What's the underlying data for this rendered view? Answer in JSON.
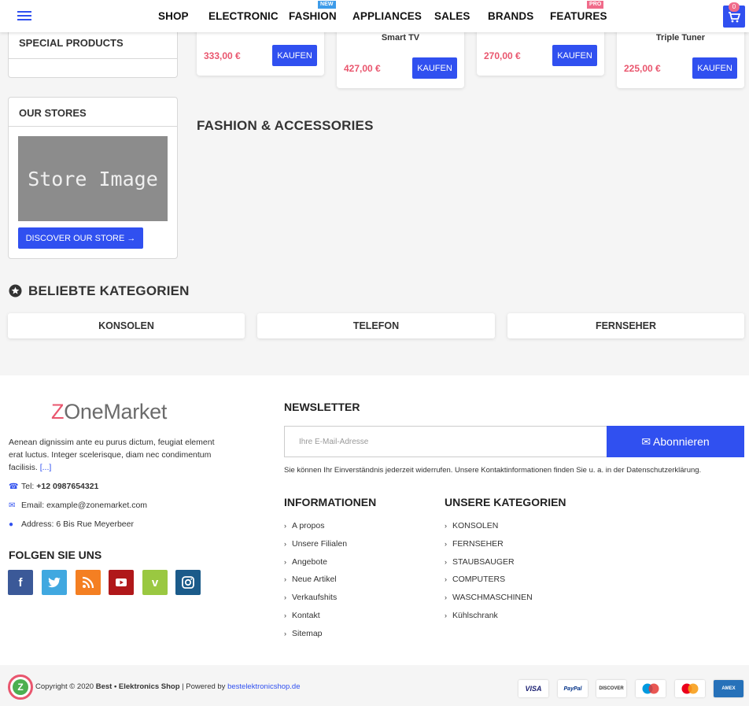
{
  "header": {
    "nav": [
      "SHOP",
      "ELECTRONIC",
      "FASHION",
      "APPLIANCES",
      "SALES",
      "BRANDS",
      "FEATURES"
    ],
    "badge_new": "NEW",
    "badge_pro": "PRO",
    "cart_count": "0"
  },
  "sidebar": {
    "special_title": "SPECIAL PRODUCTS",
    "stores_title": "OUR STORES",
    "store_image_text": "Store Image",
    "discover_label": "DISCOVER OUR STORE →"
  },
  "products": [
    {
      "name": "",
      "price": "333,00 €",
      "button": "KAUFEN"
    },
    {
      "name": "Smart TV",
      "price": "427,00 €",
      "button": "KAUFEN"
    },
    {
      "name": "",
      "price": "270,00 €",
      "button": "KAUFEN"
    },
    {
      "name": "Triple Tuner",
      "price": "225,00 €",
      "button": "KAUFEN"
    }
  ],
  "fashion_title": "FASHION & ACCESSORIES",
  "categories": {
    "title": "BELIEBTE KATEGORIEN",
    "items": [
      "KONSOLEN",
      "TELEFON",
      "FERNSEHER"
    ]
  },
  "footer": {
    "logo_z": "Z",
    "logo_rest": "OneMarket",
    "about": "Aenean dignissim ante eu purus dictum, feugiat element erat luctus. Integer scelerisque, diam nec condimentum facilisis.",
    "about_more": "[...]",
    "tel_label": "Tel:",
    "tel": "+12 0987654321",
    "email": "Email: example@zonemarket.com",
    "address": "Address: 6 Bis Rue Meyerbeer",
    "follow_title": "FOLGEN SIE UNS",
    "newsletter_title": "NEWSLETTER",
    "newsletter_placeholder": "Ihre E-Mail-Adresse",
    "newsletter_button": "Abonnieren",
    "newsletter_note": "Sie können Ihr Einverständnis jederzeit widerrufen. Unsere Kontaktinformationen finden Sie u. a. in der Datenschutzerklärung.",
    "info_title": "INFORMATIONEN",
    "info_links": [
      "A propos",
      "Unsere Filialen",
      "Angebote",
      "Neue Artikel",
      "Verkaufshits",
      "Kontakt",
      "Sitemap"
    ],
    "cat_title": "UNSERE KATEGORIEN",
    "cat_links": [
      "KONSOLEN",
      "FERNSEHER",
      "STAUBSAUGER",
      "COMPUTERS",
      "WASCHMASCHINEN",
      "Kühlschrank"
    ],
    "copyright_pre": "Copyright © 2020",
    "copyright_shop": "Best • Elektronics Shop",
    "copyright_mid": "|  Powered by",
    "copyright_link": "bestelektronicshop.de",
    "payments": [
      "VISA",
      "PayPal",
      "DISCOVER",
      "Maestro",
      "MasterCard",
      "AMEX"
    ]
  }
}
